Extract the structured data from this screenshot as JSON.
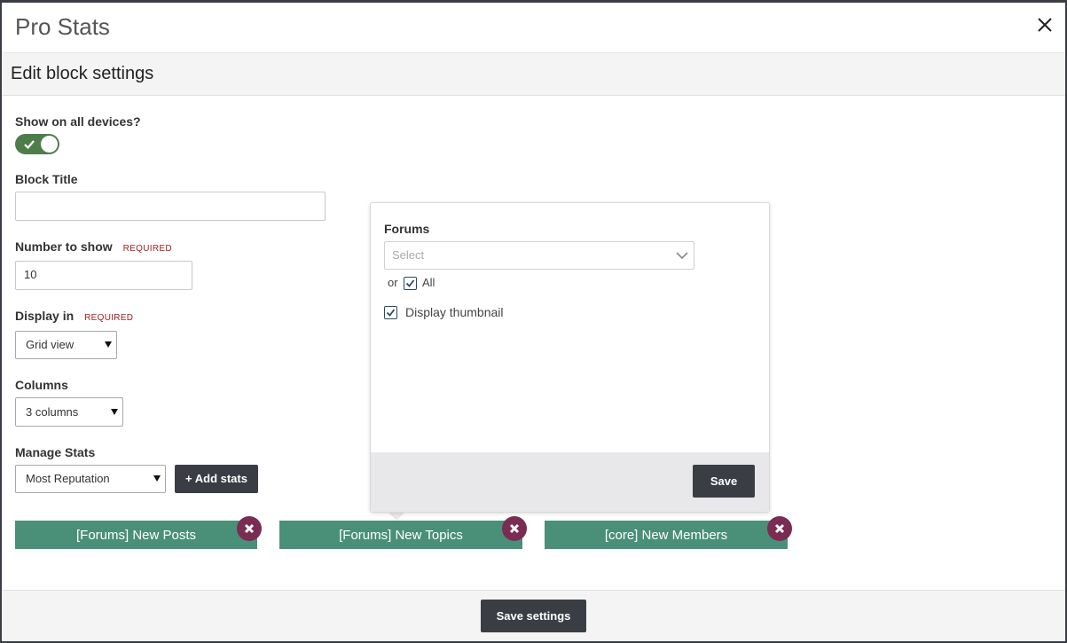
{
  "modal": {
    "title": "Pro Stats"
  },
  "subheader": {
    "title": "Edit block settings"
  },
  "form": {
    "show_all_devices_label": "Show on all devices?",
    "show_all_devices_on": true,
    "block_title_label": "Block Title",
    "block_title_value": "",
    "number_label": "Number to show",
    "required_tag": "REQUIRED",
    "number_value": "10",
    "display_label": "Display in",
    "display_value": "Grid view",
    "columns_label": "Columns",
    "columns_value": "3 columns",
    "manage_label": "Manage Stats",
    "manage_value": "Most Reputation",
    "add_stats_label": "+ Add stats"
  },
  "stats": [
    {
      "label": "[Forums] New Posts"
    },
    {
      "label": "[Forums] New Topics"
    },
    {
      "label": "[core] New Members"
    }
  ],
  "popover": {
    "forums_label": "Forums",
    "select_placeholder": "Select",
    "or_text": "or",
    "all_label": "All",
    "all_checked": true,
    "thumbnail_label": "Display thumbnail",
    "thumbnail_checked": true,
    "save_label": "Save"
  },
  "footer": {
    "save_settings_label": "Save settings"
  },
  "colors": {
    "toggle_on": "#4f7d4a",
    "stat_block": "#4a8f78",
    "remove_button": "#7a2c52",
    "dark_button": "#3a3d44"
  }
}
